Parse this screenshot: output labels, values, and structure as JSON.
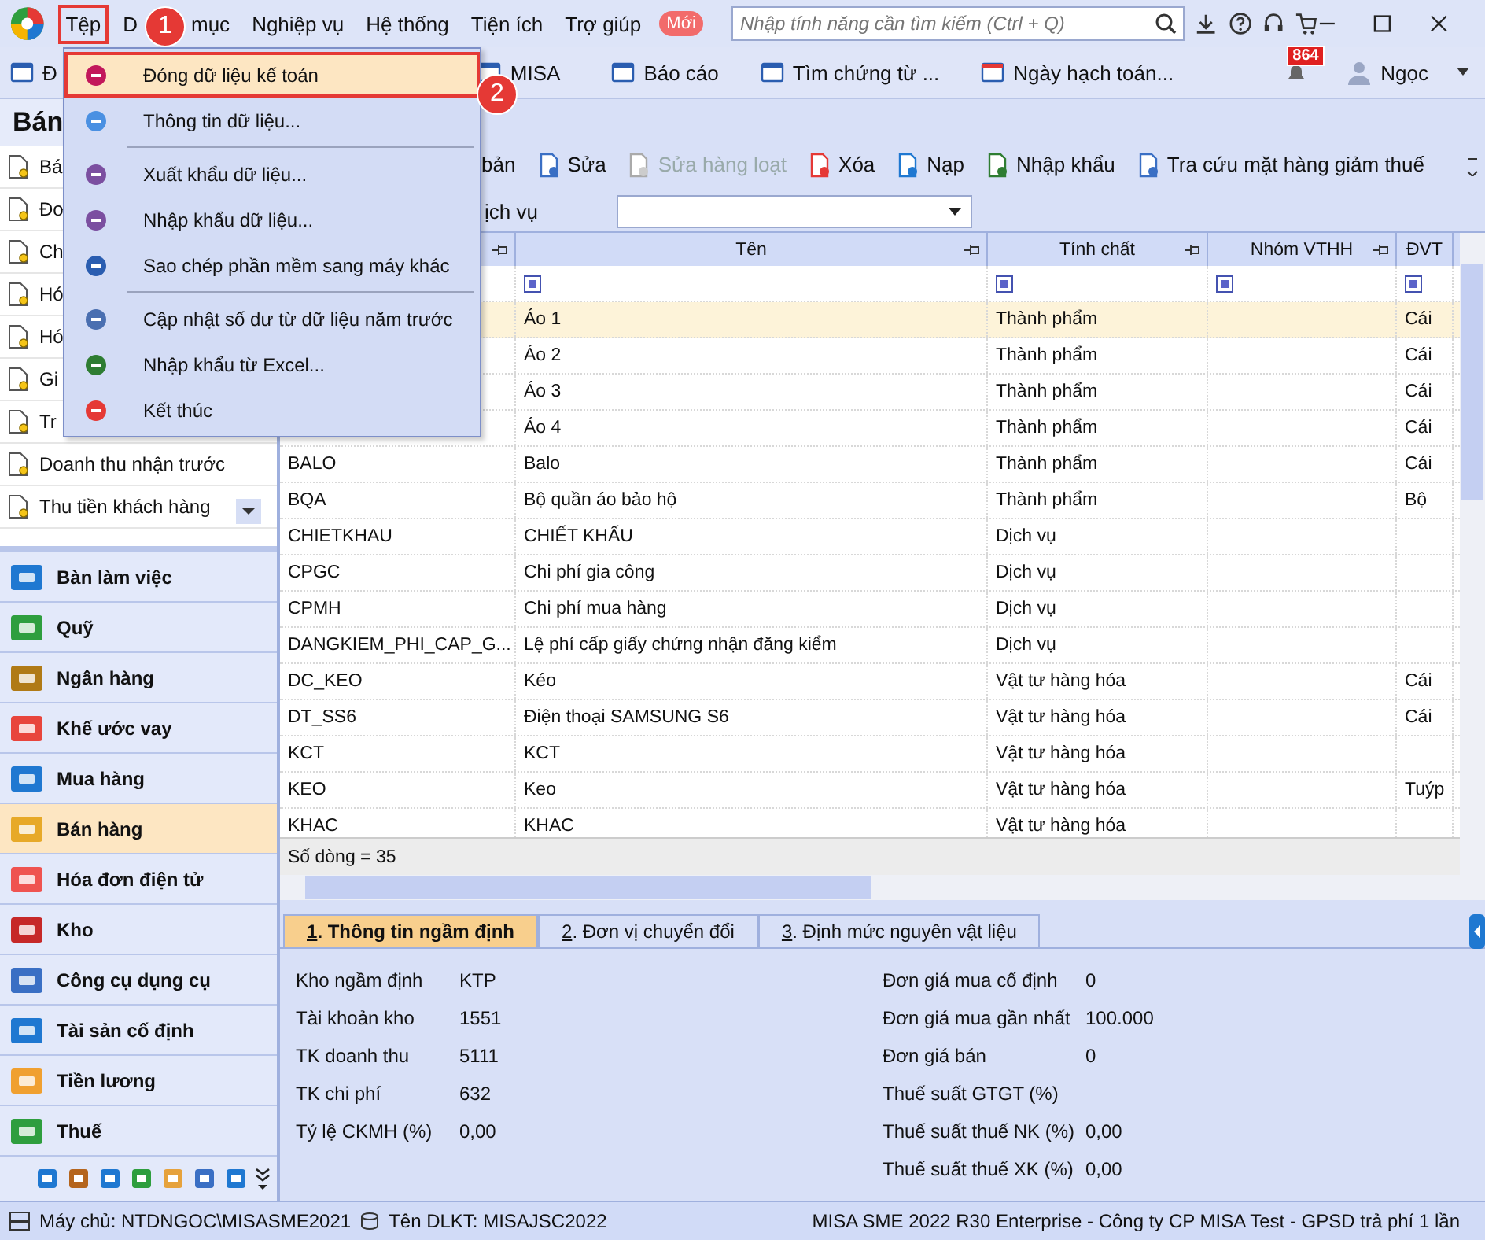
{
  "menubar": {
    "items": [
      {
        "parts": [
          "Tệp"
        ],
        "highlighted": true
      },
      {
        "parts": [
          "D",
          "mục"
        ],
        "highlighted": false
      },
      {
        "parts": [
          "Nghiệp vụ"
        ],
        "highlighted": false
      },
      {
        "parts": [
          "Hệ thống"
        ],
        "highlighted": false
      },
      {
        "parts": [
          "Tiện ích"
        ],
        "highlighted": false
      },
      {
        "parts": [
          "Trợ giúp"
        ],
        "highlighted": false
      }
    ],
    "new_badge": "Mới",
    "search": {
      "placeholder": "Nhập tính năng cần tìm kiếm (Ctrl + Q)"
    }
  },
  "toolbar": {
    "items": [
      "Đ",
      "MISA",
      "Báo cáo",
      "Tìm chứng từ ...",
      "Ngày hạch toán..."
    ],
    "notifications": "864",
    "user": "Ngọc"
  },
  "file_menu": {
    "items": [
      {
        "label": "Đóng dữ liệu kế toán",
        "selected": true,
        "separator_after": false
      },
      {
        "label": "Thông tin dữ liệu...",
        "selected": false,
        "separator_after": true
      },
      {
        "label": "Xuất khẩu dữ liệu...",
        "selected": false,
        "separator_after": false
      },
      {
        "label": "Nhập khẩu dữ liệu...",
        "selected": false,
        "separator_after": false
      },
      {
        "label": "Sao chép phần mềm sang máy khác",
        "selected": false,
        "separator_after": true
      },
      {
        "label": "Cập nhật số dư từ dữ liệu năm trước",
        "selected": false,
        "separator_after": false
      },
      {
        "label": "Nhập khẩu từ Excel...",
        "selected": false,
        "separator_after": false
      },
      {
        "label": "Kết thúc",
        "selected": false,
        "separator_after": false
      }
    ]
  },
  "callouts": [
    "1",
    "2"
  ],
  "sidebar": {
    "title": "Bán",
    "items": [
      "Bá",
      "Đơ",
      "Ch",
      "Hó",
      "Hó",
      "Gi",
      "Tr",
      "Doanh thu nhận trước",
      "Thu tiền khách hàng"
    ],
    "nav": [
      {
        "label": "Bàn làm việc",
        "selected": false
      },
      {
        "label": "Quỹ",
        "selected": false
      },
      {
        "label": "Ngân hàng",
        "selected": false
      },
      {
        "label": "Khế ước vay",
        "selected": false
      },
      {
        "label": "Mua hàng",
        "selected": false
      },
      {
        "label": "Bán hàng",
        "selected": true
      },
      {
        "label": "Hóa đơn điện tử",
        "selected": false
      },
      {
        "label": "Kho",
        "selected": false
      },
      {
        "label": "Công cụ dụng cụ",
        "selected": false
      },
      {
        "label": "Tài sản cố định",
        "selected": false
      },
      {
        "label": "Tiền lương",
        "selected": false
      },
      {
        "label": "Thuế",
        "selected": false
      }
    ]
  },
  "content": {
    "actions": [
      {
        "label": "bản",
        "disabled": false
      },
      {
        "label": "Sửa",
        "disabled": false
      },
      {
        "label": "Sửa hàng loạt",
        "disabled": true
      },
      {
        "label": "Xóa",
        "disabled": false
      },
      {
        "label": "Nạp",
        "disabled": false
      },
      {
        "label": "Nhập khẩu",
        "disabled": false
      },
      {
        "label": "Tra cứu mặt hàng giảm thuế",
        "disabled": false
      }
    ],
    "filter_label": "ịch vụ",
    "table": {
      "columns": [
        "Tên",
        "Tính chất",
        "Nhóm VTHH",
        "ĐVT"
      ],
      "rows": [
        {
          "name": "Áo 1",
          "nature": "Thành phẩm",
          "unit": "Cái",
          "selected": true
        },
        {
          "name": "Áo 2",
          "nature": "Thành phẩm",
          "unit": "Cái",
          "selected": false
        },
        {
          "name": "Áo 3",
          "nature": "Thành phẩm",
          "unit": "Cái",
          "selected": false
        },
        {
          "name": "Áo 4",
          "nature": "Thành phẩm",
          "unit": "Cái",
          "selected": false
        },
        {
          "code": "BALO",
          "name": "Balo",
          "nature": "Thành phẩm",
          "unit": "Cái",
          "selected": false
        },
        {
          "code": "BQA",
          "name": "Bộ quần áo bảo hộ",
          "nature": "Thành phẩm",
          "unit": "Bộ",
          "selected": false
        },
        {
          "code": "CHIETKHAU",
          "name": "CHIẾT KHẤU",
          "nature": "Dịch vụ",
          "selected": false
        },
        {
          "code": "CPGC",
          "name": "Chi phí gia công",
          "nature": "Dịch vụ",
          "selected": false
        },
        {
          "code": "CPMH",
          "name": "Chi phí mua hàng",
          "nature": "Dịch vụ",
          "selected": false
        },
        {
          "code": "DANGKIEM_PHI_CAP_G...",
          "name": "Lệ phí cấp giấy chứng nhận đăng kiểm",
          "nature": "Dịch vụ",
          "selected": false
        },
        {
          "code": "DC_KEO",
          "name": "Kéo",
          "nature": "Vật tư hàng hóa",
          "unit": "Cái",
          "selected": false
        },
        {
          "code": "DT_SS6",
          "name": "Điện thoại SAMSUNG S6",
          "nature": "Vật tư hàng hóa",
          "unit": "Cái",
          "selected": false
        },
        {
          "code": "KCT",
          "name": "KCT",
          "nature": "Vật tư hàng hóa",
          "selected": false
        },
        {
          "code": "KEO",
          "name": "Keo",
          "nature": "Vật tư hàng hóa",
          "unit": "Tuýp",
          "selected": false
        },
        {
          "code": "KHAC",
          "name": "KHAC",
          "nature": "Vật tư hàng hóa",
          "selected": false
        }
      ],
      "footer": "Số dòng = 35"
    },
    "tabs": [
      {
        "key": "1",
        "label": ". Thông tin ngầm định",
        "selected": true
      },
      {
        "key": "2",
        "label": ". Đơn vị chuyển đổi",
        "selected": false
      },
      {
        "key": "3",
        "label": ". Định mức nguyên vật liệu",
        "selected": false
      }
    ],
    "details_left": [
      {
        "label": "Kho ngầm định",
        "value": "KTP"
      },
      {
        "label": "Tài khoản kho",
        "value": "1551"
      },
      {
        "label": "TK doanh thu",
        "value": "5111"
      },
      {
        "label": "TK chi phí",
        "value": "632"
      },
      {
        "label": "Tỷ lệ CKMH (%)",
        "value": "0,00"
      }
    ],
    "details_right": [
      {
        "label": "Đơn giá mua cố định",
        "value": "0"
      },
      {
        "label": "Đơn giá mua gần nhất",
        "value": "100.000"
      },
      {
        "label": "Đơn giá bán",
        "value": "0"
      },
      {
        "label": "Thuế suất GTGT (%)"
      },
      {
        "label": "Thuế suất thuế NK (%)",
        "value": "0,00"
      },
      {
        "label": "Thuế suất thuế XK (%)",
        "value": "0,00"
      }
    ]
  },
  "status_bar": {
    "server": "Máy chủ: NTDNGOC\\MISASME2021",
    "database": "Tên DLKT: MISAJSC2022",
    "license": "MISA SME 2022 R30 Enterprise - Công ty CP MISA Test - GPSD trả phí 1 lần"
  }
}
